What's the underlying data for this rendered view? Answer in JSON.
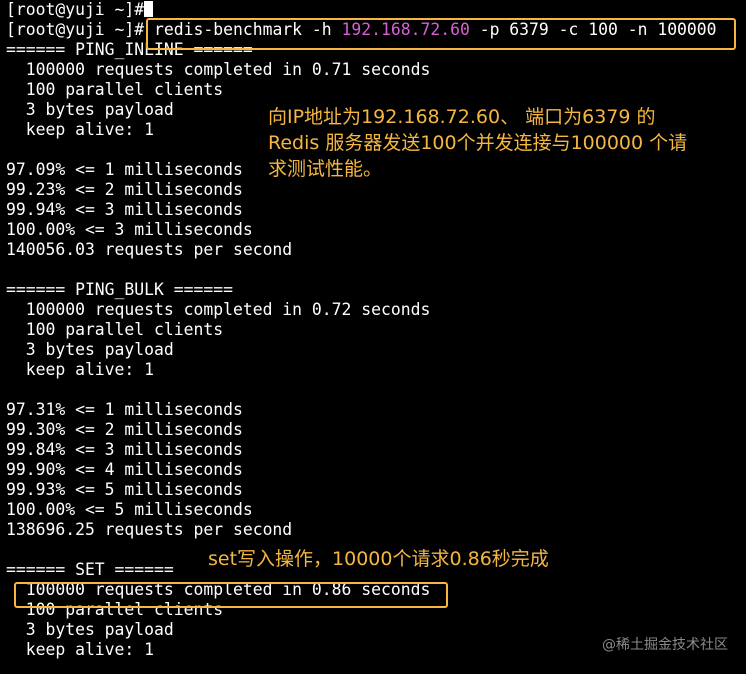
{
  "terminal": {
    "prompt": "[root@yuji ~]#",
    "cursor": "",
    "command_prefix": "redis-benchmark -h ",
    "command_ip": "192.168.72.60",
    "command_suffix": " -p 6379 -c 100 -n 100000",
    "lines": [
      "====== PING_INLINE ======",
      "  100000 requests completed in 0.71 seconds",
      "  100 parallel clients",
      "  3 bytes payload",
      "  keep alive: 1",
      "",
      "97.09% <= 1 milliseconds",
      "99.23% <= 2 milliseconds",
      "99.94% <= 3 milliseconds",
      "100.00% <= 3 milliseconds",
      "140056.03 requests per second",
      "",
      "====== PING_BULK ======",
      "  100000 requests completed in 0.72 seconds",
      "  100 parallel clients",
      "  3 bytes payload",
      "  keep alive: 1",
      "",
      "97.31% <= 1 milliseconds",
      "99.30% <= 2 milliseconds",
      "99.84% <= 3 milliseconds",
      "99.90% <= 4 milliseconds",
      "99.93% <= 5 milliseconds",
      "100.00% <= 5 milliseconds",
      "138696.25 requests per second",
      "",
      "====== SET ======",
      "  100000 requests completed in 0.86 seconds",
      "  100 parallel clients",
      "  3 bytes payload",
      "  keep alive: 1"
    ]
  },
  "annotations": {
    "command_note_line1": "向IP地址为192.168.72.60、 端口为6379 的",
    "command_note_line2": "Redis 服务器发送100个并发连接与100000 个请",
    "command_note_line3": "求测试性能。",
    "set_note": "set写入操作，10000个请求0.86秒完成"
  },
  "watermark": "@稀土掘金技术社区",
  "colors": {
    "background": "#000000",
    "text": "#ffffff",
    "ip_highlight": "#d75fd7",
    "annotation": "#f5b642"
  }
}
